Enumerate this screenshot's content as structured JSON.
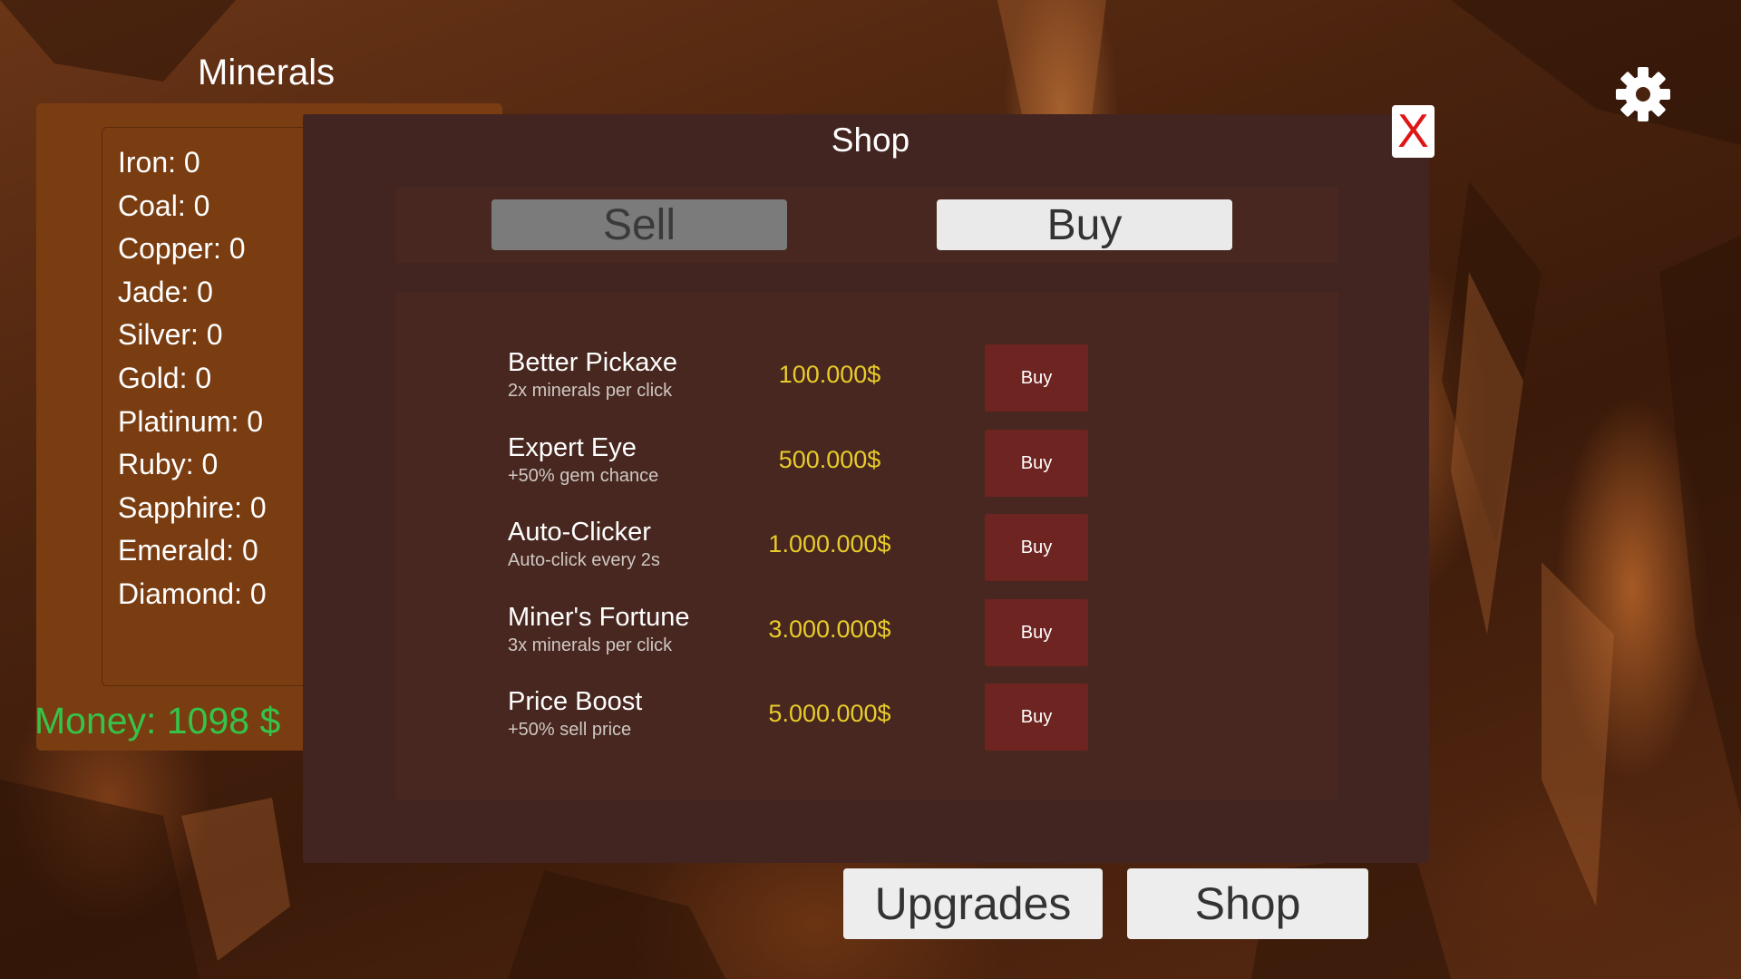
{
  "minerals": {
    "title": "Minerals",
    "items": [
      "Iron: 0",
      "Coal: 0",
      "Copper: 0",
      "Jade: 0",
      "Silver: 0",
      "Gold: 0",
      "Platinum: 0",
      "Ruby: 0",
      "Sapphire: 0",
      "Emerald: 0",
      "Diamond: 0"
    ],
    "money": "Money: 1098 $"
  },
  "shop": {
    "title": "Shop",
    "close_label": "X",
    "tabs": {
      "sell": "Sell",
      "buy": "Buy",
      "active": "buy"
    },
    "items": [
      {
        "name": "Better Pickaxe",
        "desc": "2x minerals per click",
        "price": "100.000$",
        "button": "Buy"
      },
      {
        "name": "Expert Eye",
        "desc": "+50% gem chance",
        "price": "500.000$",
        "button": "Buy"
      },
      {
        "name": "Auto-Clicker",
        "desc": "Auto-click every 2s",
        "price": "1.000.000$",
        "button": "Buy"
      },
      {
        "name": "Miner's Fortune",
        "desc": "3x minerals per click",
        "price": "3.000.000$",
        "button": "Buy"
      },
      {
        "name": "Price Boost",
        "desc": "+50% sell price",
        "price": "5.000.000$",
        "button": "Buy"
      }
    ]
  },
  "settings_icon": "gear-icon",
  "bottom_nav": {
    "upgrades": "Upgrades",
    "shop": "Shop"
  },
  "colors": {
    "money": "#35c44a",
    "price": "#e8cc2a",
    "buy_button": "#6e2421",
    "close_x": "#e01515",
    "modal_bg": "#422420",
    "panel_bg": "#7a3d12"
  }
}
